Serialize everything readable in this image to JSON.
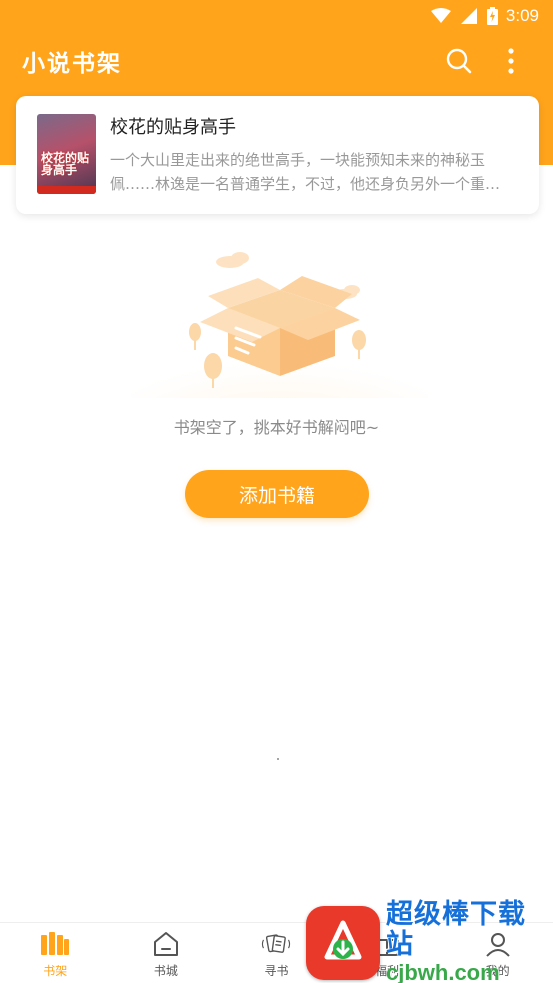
{
  "status_bar": {
    "time": "3:09",
    "icons": [
      "wifi-icon",
      "signal-icon",
      "battery-icon"
    ]
  },
  "app_bar": {
    "title": "小说书架",
    "actions": [
      "search-icon",
      "more-vert-icon"
    ]
  },
  "book": {
    "title": "校花的贴身高手",
    "description": "一个大山里走出来的绝世高手，一块能预知未来的神秘玉佩……林逸是一名普通学生，不过，他还身负另外一个重任……",
    "cover_text": "校花的贴身高手"
  },
  "empty_state": {
    "message": "书架空了，挑本好书解闷吧~",
    "button_label": "添加书籍"
  },
  "bottom_nav": {
    "items": [
      {
        "label": "书架",
        "icon": "bookshelf-icon",
        "active": true
      },
      {
        "label": "书城",
        "icon": "store-icon",
        "active": false
      },
      {
        "label": "寻书",
        "icon": "find-book-icon",
        "active": false
      },
      {
        "label": "福利",
        "icon": "gift-icon",
        "active": false
      },
      {
        "label": "我的",
        "icon": "profile-icon",
        "active": false
      }
    ]
  },
  "watermark": {
    "main_text": "超级棒下载站",
    "url_text": "cjbwh.com"
  },
  "colors": {
    "accent": "#FFA41B",
    "muted_text": "#999999"
  }
}
